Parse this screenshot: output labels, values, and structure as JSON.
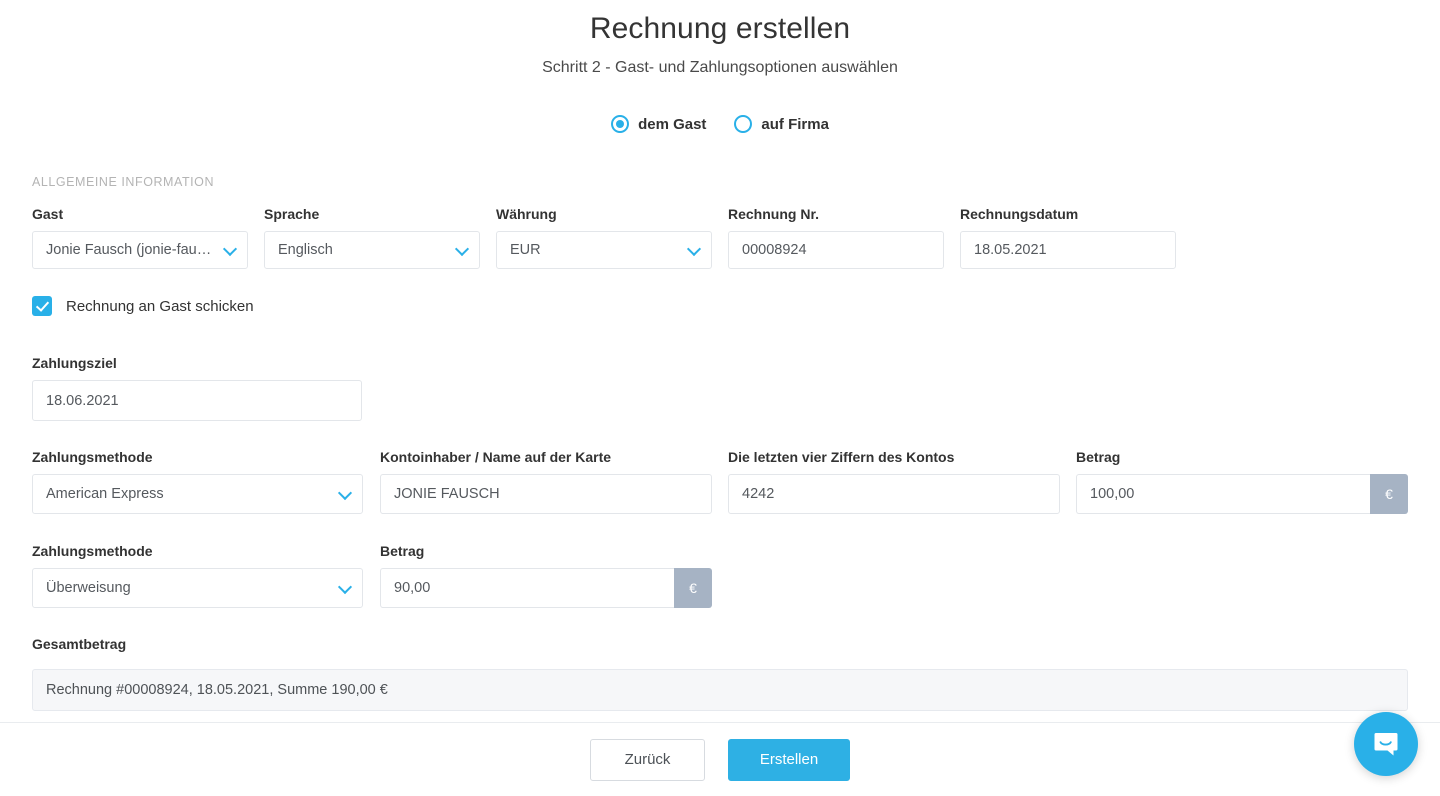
{
  "header": {
    "title": "Rechnung erstellen",
    "subtitle": "Schritt 2 - Gast- und Zahlungsoptionen auswählen"
  },
  "recipient": {
    "options": [
      {
        "label": "dem Gast",
        "selected": true
      },
      {
        "label": "auf Firma",
        "selected": false
      }
    ]
  },
  "general": {
    "section_label": "ALLGEMEINE INFORMATION",
    "guest": {
      "label": "Gast",
      "value": "Jonie Fausch (jonie-fau…",
      "icon": "chevron-down-icon"
    },
    "language": {
      "label": "Sprache",
      "value": "Englisch",
      "icon": "chevron-down-icon"
    },
    "currency": {
      "label": "Währung",
      "value": "EUR",
      "icon": "chevron-down-icon"
    },
    "invoice_number": {
      "label": "Rechnung Nr.",
      "value": "00008924"
    },
    "invoice_date": {
      "label": "Rechnungsdatum",
      "value": "18.05.2021"
    },
    "send_to_guest": {
      "label": "Rechnung an Gast schicken",
      "checked": true
    }
  },
  "due": {
    "label": "Zahlungsziel",
    "value": "18.06.2021"
  },
  "payments": [
    {
      "method": {
        "label": "Zahlungsmethode",
        "value": "American Express"
      },
      "holder": {
        "label": "Kontoinhaber / Name auf der Karte",
        "value": "JONIE FAUSCH"
      },
      "last_four": {
        "label": "Die letzten vier Ziffern des Kontos",
        "value": "4242"
      },
      "amount": {
        "label": "Betrag",
        "value": "100,00",
        "suffix": "€"
      }
    },
    {
      "method": {
        "label": "Zahlungsmethode",
        "value": "Überweisung"
      },
      "amount": {
        "label": "Betrag",
        "value": "90,00",
        "suffix": "€"
      }
    }
  ],
  "total": {
    "label": "Gesamtbetrag",
    "summary": "Rechnung #00008924, 18.05.2021, Summe 190,00 €"
  },
  "footer": {
    "back_label": "Zurück",
    "create_label": "Erstellen"
  },
  "support": {
    "launcher_icon": "chat-bubble-icon"
  },
  "colors": {
    "accent": "#29b0e8",
    "suffix_bg": "#a6b3c4",
    "border": "#e3e6ea"
  }
}
